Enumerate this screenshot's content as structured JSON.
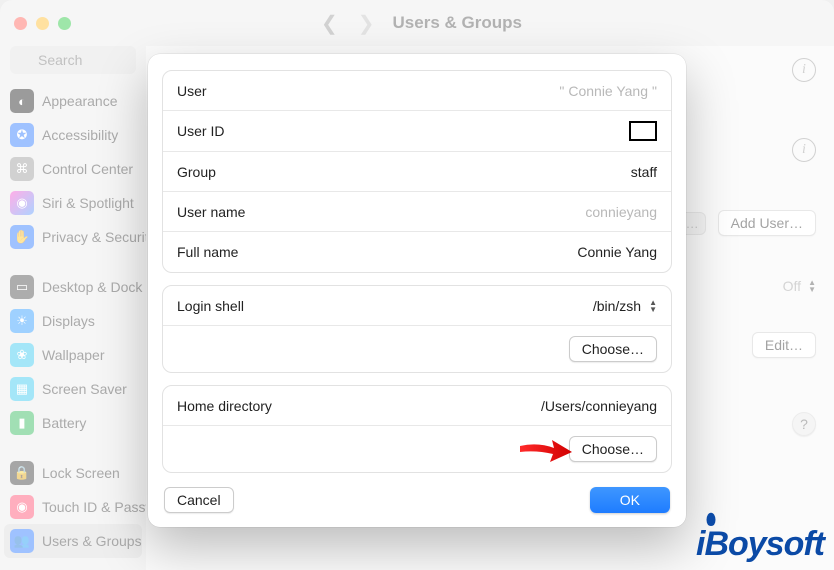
{
  "titlebar": {
    "title": "Users & Groups"
  },
  "search": {
    "placeholder": "Search"
  },
  "sidebar": {
    "items": [
      {
        "label": "Appearance",
        "color": "#222"
      },
      {
        "label": "Accessibility",
        "color": "#2b79ff"
      },
      {
        "label": "Control Center",
        "color": "#9a9a9a"
      },
      {
        "label": "Siri & Spotlight",
        "color": "linear"
      },
      {
        "label": "Privacy & Security",
        "color": "#2b79ff"
      },
      {
        "label": "Desktop & Dock",
        "color": "#4a4a4a"
      },
      {
        "label": "Displays",
        "color": "#2b9aff"
      },
      {
        "label": "Wallpaper",
        "color": "#35c8ef"
      },
      {
        "label": "Screen Saver",
        "color": "#35c8ef"
      },
      {
        "label": "Battery",
        "color": "#2fb85a"
      },
      {
        "label": "Lock Screen",
        "color": "#3a3a3a"
      },
      {
        "label": "Touch ID & Password",
        "color": "#ff4d70"
      },
      {
        "label": "Users & Groups",
        "color": "#2b79ff"
      }
    ]
  },
  "content": {
    "add_user": "Add User…",
    "off_label": "Off",
    "edit_label": "Edit…",
    "segmented_more": "…"
  },
  "sheet": {
    "rows": {
      "user_label": "User",
      "user_value": "Connie Yang",
      "userid_label": "User ID",
      "group_label": "Group",
      "group_value": "staff",
      "username_label": "User name",
      "username_value": "connieyang",
      "fullname_label": "Full name",
      "fullname_value": "Connie Yang",
      "loginshell_label": "Login shell",
      "loginshell_value": "/bin/zsh",
      "choose_label": "Choose…",
      "homedir_label": "Home directory",
      "homedir_value": "/Users/connieyang"
    },
    "footer": {
      "cancel": "Cancel",
      "ok": "OK"
    }
  },
  "watermark": "iBoysoft"
}
